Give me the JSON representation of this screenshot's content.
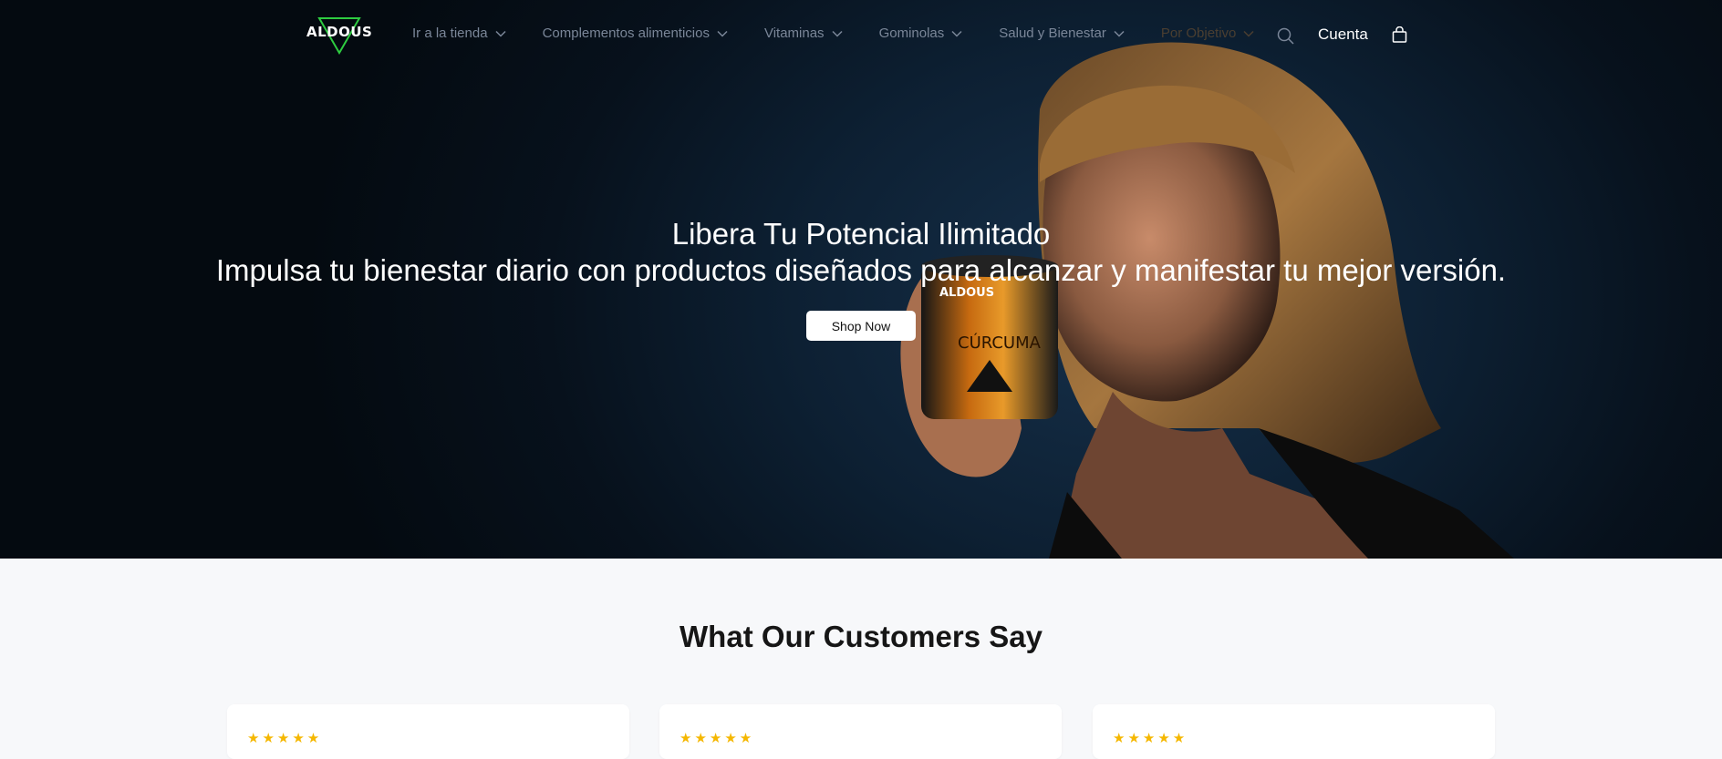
{
  "brand": {
    "logo_text": "ALDOUS",
    "accent": "#2ecc40"
  },
  "nav": {
    "items": [
      {
        "label": "Ir a la tienda"
      },
      {
        "label": "Complementos alimenticios"
      },
      {
        "label": "Vitaminas"
      },
      {
        "label": "Gominolas"
      },
      {
        "label": "Salud y Bienestar"
      },
      {
        "label": "Por Objetivo"
      }
    ],
    "account_label": "Cuenta"
  },
  "hero": {
    "title": "Libera Tu Potencial Ilimitado",
    "subtitle": "Impulsa tu bienestar diario con productos diseñados para alcanzar y manifestar tu mejor versión.",
    "cta_label": "Shop Now",
    "product_label": "CÚRCUMA",
    "product_brand": "ALDOUS"
  },
  "testimonials": {
    "title": "What Our Customers Say",
    "cards": [
      {
        "stars": "★★★★★"
      },
      {
        "stars": "★★★★★"
      },
      {
        "stars": "★★★★★"
      }
    ],
    "star_color": "#f5b700"
  }
}
